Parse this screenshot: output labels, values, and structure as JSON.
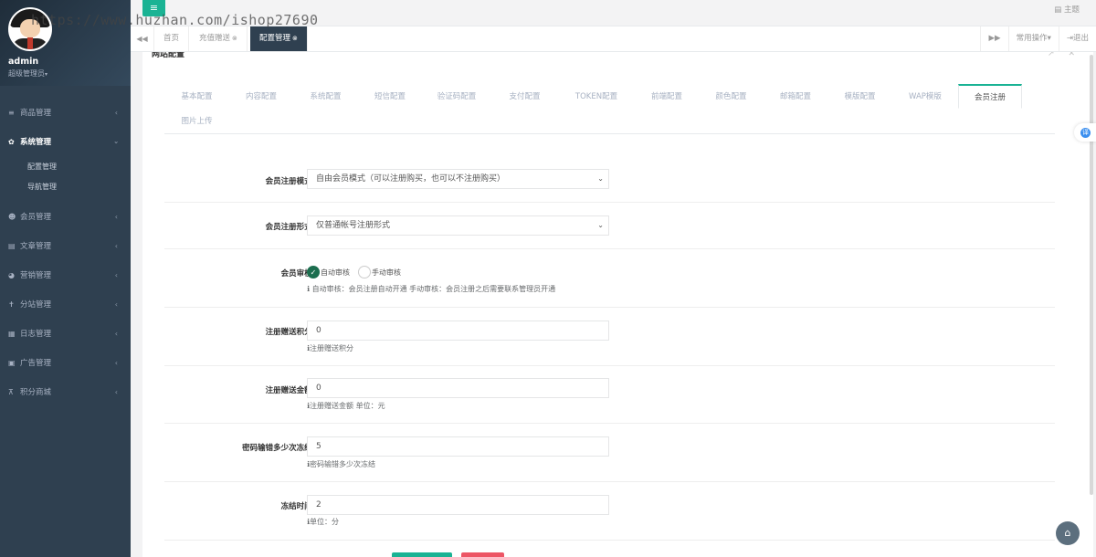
{
  "watermark": "https://www.huzhan.com/ishop27690",
  "sidebar": {
    "user": {
      "name": "admin",
      "role": "超级管理员",
      "role_caret": "▾"
    },
    "items": [
      {
        "label": "商品管理",
        "icon": "≡",
        "arrow": "‹"
      },
      {
        "label": "系统管理",
        "icon": "✿",
        "arrow": "‹"
      },
      {
        "label": "会员管理",
        "icon": "☻",
        "arrow": "‹"
      },
      {
        "label": "文章管理",
        "icon": "▤",
        "arrow": "‹"
      },
      {
        "label": "营销管理",
        "icon": "◕",
        "arrow": "‹"
      },
      {
        "label": "分站管理",
        "icon": "✝",
        "arrow": "‹"
      },
      {
        "label": "日志管理",
        "icon": "▦",
        "arrow": "‹"
      },
      {
        "label": "广告管理",
        "icon": "▣",
        "arrow": "‹"
      },
      {
        "label": "积分商城",
        "icon": "⊼",
        "arrow": "‹"
      }
    ],
    "sub_items": [
      "配置管理",
      "导航管理"
    ]
  },
  "topbar": {
    "menu_icon": "≡",
    "theme_icon": "▤",
    "theme_label": "主题"
  },
  "tabbar": {
    "left_arrow": "◀◀",
    "right_arrow": "▶▶",
    "tabs": [
      {
        "label": "首页",
        "close": ""
      },
      {
        "label": "充值赠送",
        "close": "⊗"
      },
      {
        "label": "配置管理",
        "close": "⊗"
      }
    ],
    "common_ops": "常用操作",
    "common_ops_caret": "▾",
    "logout_icon": "⇥",
    "logout": "退出"
  },
  "panel": {
    "title": "网站配置",
    "tools": "⌃ ↗ ✕"
  },
  "config_tabs": [
    "基本配置",
    "内容配置",
    "系统配置",
    "短信配置",
    "验证码配置",
    "支付配置",
    "TOKEN配置",
    "前端配置",
    "颜色配置",
    "邮箱配置",
    "模版配置",
    "WAP模版",
    "会员注册",
    "图片上传"
  ],
  "form": {
    "reg_mode": {
      "label": "会员注册模式:",
      "value": "自由会员模式（可以注册购买，也可以不注册购买）",
      "arrow": "⌄"
    },
    "reg_form": {
      "label": "会员注册形式:",
      "value": "仅普通帐号注册形式",
      "arrow": "⌄"
    },
    "audit": {
      "label": "会员审核:",
      "options": [
        "自动审核",
        "手动审核"
      ],
      "selected": 0,
      "check": "✓",
      "help_icon": "ℹ",
      "help": "自动审核：会员注册自动开通 手动审核：会员注册之后需要联系管理员开通"
    },
    "reg_points": {
      "label": "注册赠送积分:",
      "value": "0",
      "help": "注册赠送积分"
    },
    "reg_money": {
      "label": "注册赠送金额:",
      "value": "0",
      "help": "注册赠送金额 单位：元"
    },
    "pwd_errors": {
      "label": "密码输错多少次冻结:",
      "value": "5",
      "help": "密码输错多少次冻结"
    },
    "freeze_time": {
      "label": "冻结时间:",
      "value": "2",
      "help": "单位：分"
    }
  },
  "floating": {
    "translate_icon": "译",
    "home_icon": "⌂"
  },
  "colors": {
    "accent": "#1ab394",
    "sidebar_bg": "#2f4050",
    "danger": "#ed5565",
    "radio_on": "#1c6e4f"
  }
}
